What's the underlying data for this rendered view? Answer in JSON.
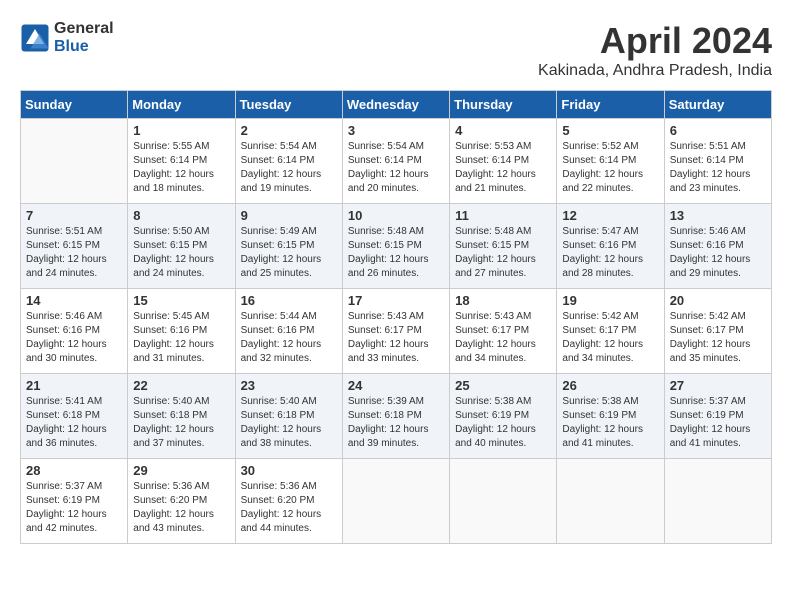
{
  "header": {
    "logo_general": "General",
    "logo_blue": "Blue",
    "month": "April 2024",
    "location": "Kakinada, Andhra Pradesh, India"
  },
  "days_of_week": [
    "Sunday",
    "Monday",
    "Tuesday",
    "Wednesday",
    "Thursday",
    "Friday",
    "Saturday"
  ],
  "weeks": [
    [
      {
        "day": "",
        "info": ""
      },
      {
        "day": "1",
        "info": "Sunrise: 5:55 AM\nSunset: 6:14 PM\nDaylight: 12 hours\nand 18 minutes."
      },
      {
        "day": "2",
        "info": "Sunrise: 5:54 AM\nSunset: 6:14 PM\nDaylight: 12 hours\nand 19 minutes."
      },
      {
        "day": "3",
        "info": "Sunrise: 5:54 AM\nSunset: 6:14 PM\nDaylight: 12 hours\nand 20 minutes."
      },
      {
        "day": "4",
        "info": "Sunrise: 5:53 AM\nSunset: 6:14 PM\nDaylight: 12 hours\nand 21 minutes."
      },
      {
        "day": "5",
        "info": "Sunrise: 5:52 AM\nSunset: 6:14 PM\nDaylight: 12 hours\nand 22 minutes."
      },
      {
        "day": "6",
        "info": "Sunrise: 5:51 AM\nSunset: 6:14 PM\nDaylight: 12 hours\nand 23 minutes."
      }
    ],
    [
      {
        "day": "7",
        "info": "Sunrise: 5:51 AM\nSunset: 6:15 PM\nDaylight: 12 hours\nand 24 minutes."
      },
      {
        "day": "8",
        "info": "Sunrise: 5:50 AM\nSunset: 6:15 PM\nDaylight: 12 hours\nand 24 minutes."
      },
      {
        "day": "9",
        "info": "Sunrise: 5:49 AM\nSunset: 6:15 PM\nDaylight: 12 hours\nand 25 minutes."
      },
      {
        "day": "10",
        "info": "Sunrise: 5:48 AM\nSunset: 6:15 PM\nDaylight: 12 hours\nand 26 minutes."
      },
      {
        "day": "11",
        "info": "Sunrise: 5:48 AM\nSunset: 6:15 PM\nDaylight: 12 hours\nand 27 minutes."
      },
      {
        "day": "12",
        "info": "Sunrise: 5:47 AM\nSunset: 6:16 PM\nDaylight: 12 hours\nand 28 minutes."
      },
      {
        "day": "13",
        "info": "Sunrise: 5:46 AM\nSunset: 6:16 PM\nDaylight: 12 hours\nand 29 minutes."
      }
    ],
    [
      {
        "day": "14",
        "info": "Sunrise: 5:46 AM\nSunset: 6:16 PM\nDaylight: 12 hours\nand 30 minutes."
      },
      {
        "day": "15",
        "info": "Sunrise: 5:45 AM\nSunset: 6:16 PM\nDaylight: 12 hours\nand 31 minutes."
      },
      {
        "day": "16",
        "info": "Sunrise: 5:44 AM\nSunset: 6:16 PM\nDaylight: 12 hours\nand 32 minutes."
      },
      {
        "day": "17",
        "info": "Sunrise: 5:43 AM\nSunset: 6:17 PM\nDaylight: 12 hours\nand 33 minutes."
      },
      {
        "day": "18",
        "info": "Sunrise: 5:43 AM\nSunset: 6:17 PM\nDaylight: 12 hours\nand 34 minutes."
      },
      {
        "day": "19",
        "info": "Sunrise: 5:42 AM\nSunset: 6:17 PM\nDaylight: 12 hours\nand 34 minutes."
      },
      {
        "day": "20",
        "info": "Sunrise: 5:42 AM\nSunset: 6:17 PM\nDaylight: 12 hours\nand 35 minutes."
      }
    ],
    [
      {
        "day": "21",
        "info": "Sunrise: 5:41 AM\nSunset: 6:18 PM\nDaylight: 12 hours\nand 36 minutes."
      },
      {
        "day": "22",
        "info": "Sunrise: 5:40 AM\nSunset: 6:18 PM\nDaylight: 12 hours\nand 37 minutes."
      },
      {
        "day": "23",
        "info": "Sunrise: 5:40 AM\nSunset: 6:18 PM\nDaylight: 12 hours\nand 38 minutes."
      },
      {
        "day": "24",
        "info": "Sunrise: 5:39 AM\nSunset: 6:18 PM\nDaylight: 12 hours\nand 39 minutes."
      },
      {
        "day": "25",
        "info": "Sunrise: 5:38 AM\nSunset: 6:19 PM\nDaylight: 12 hours\nand 40 minutes."
      },
      {
        "day": "26",
        "info": "Sunrise: 5:38 AM\nSunset: 6:19 PM\nDaylight: 12 hours\nand 41 minutes."
      },
      {
        "day": "27",
        "info": "Sunrise: 5:37 AM\nSunset: 6:19 PM\nDaylight: 12 hours\nand 41 minutes."
      }
    ],
    [
      {
        "day": "28",
        "info": "Sunrise: 5:37 AM\nSunset: 6:19 PM\nDaylight: 12 hours\nand 42 minutes."
      },
      {
        "day": "29",
        "info": "Sunrise: 5:36 AM\nSunset: 6:20 PM\nDaylight: 12 hours\nand 43 minutes."
      },
      {
        "day": "30",
        "info": "Sunrise: 5:36 AM\nSunset: 6:20 PM\nDaylight: 12 hours\nand 44 minutes."
      },
      {
        "day": "",
        "info": ""
      },
      {
        "day": "",
        "info": ""
      },
      {
        "day": "",
        "info": ""
      },
      {
        "day": "",
        "info": ""
      }
    ]
  ]
}
